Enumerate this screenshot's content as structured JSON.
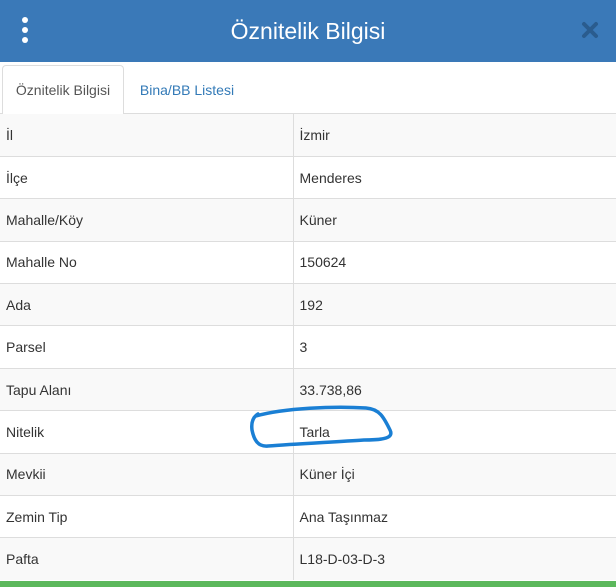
{
  "header": {
    "title": "Öznitelik Bilgisi",
    "menu_icon": "vertical-ellipsis-icon",
    "close_icon": "close-x-icon"
  },
  "tabs": [
    {
      "label": "Öznitelik Bilgisi",
      "active": true
    },
    {
      "label": "Bina/BB Listesi",
      "active": false
    }
  ],
  "attributes": [
    {
      "key": "İl",
      "value": "İzmir"
    },
    {
      "key": "İlçe",
      "value": "Menderes"
    },
    {
      "key": "Mahalle/Köy",
      "value": "Küner"
    },
    {
      "key": "Mahalle No",
      "value": "150624"
    },
    {
      "key": "Ada",
      "value": "192"
    },
    {
      "key": "Parsel",
      "value": "3"
    },
    {
      "key": "Tapu Alanı",
      "value": "33.738,86"
    },
    {
      "key": "Nitelik",
      "value": "Tarla"
    },
    {
      "key": "Mevkii",
      "value": "Küner İçi"
    },
    {
      "key": "Zemin Tip",
      "value": "Ana Taşınmaz"
    },
    {
      "key": "Pafta",
      "value": "L18-D-03-D-3"
    }
  ],
  "colors": {
    "header_bg": "#3a79b8",
    "tab_link": "#337ab7",
    "annotation_stroke": "#1a7fd4",
    "footer_bar": "#5cb85c"
  }
}
